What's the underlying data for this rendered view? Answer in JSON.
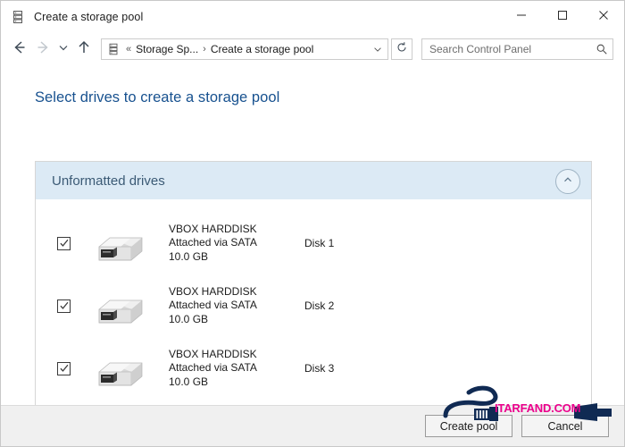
{
  "window": {
    "title": "Create a storage pool",
    "title_icon": "storage-pool-icon",
    "controls": {
      "minimize": "minimize-icon",
      "maximize": "maximize-icon",
      "close": "close-icon"
    }
  },
  "navigation": {
    "back": "back-arrow-icon",
    "forward": "forward-arrow-icon",
    "history": "chevron-down-icon",
    "up": "up-arrow-icon",
    "breadcrumb": {
      "icon": "storage-pool-icon",
      "overflow": "«",
      "parent": "Storage Sp...",
      "separator": "›",
      "current": "Create a storage pool",
      "dropdown": "chevron-down-icon"
    },
    "refresh": "refresh-icon"
  },
  "search": {
    "placeholder": "Search Control Panel",
    "value": "",
    "icon": "search-icon"
  },
  "main": {
    "page_title": "Select drives to create a storage pool",
    "panel": {
      "header": "Unformatted drives",
      "collapse_icon": "chevron-up-icon",
      "collapsed": false,
      "drives": [
        {
          "checked": true,
          "icon": "hard-disk-icon",
          "name": "VBOX HARDDISK",
          "attachment": "Attached via SATA",
          "capacity": "10.0 GB",
          "slot": "Disk 1"
        },
        {
          "checked": true,
          "icon": "hard-disk-icon",
          "name": "VBOX HARDDISK",
          "attachment": "Attached via SATA",
          "capacity": "10.0 GB",
          "slot": "Disk 2"
        },
        {
          "checked": true,
          "icon": "hard-disk-icon",
          "name": "VBOX HARDDISK",
          "attachment": "Attached via SATA",
          "capacity": "10.0 GB",
          "slot": "Disk 3"
        }
      ]
    }
  },
  "footer": {
    "create_pool_label": "Create pool",
    "cancel_label": "Cancel"
  },
  "watermark": {
    "text": "ITARFAND.COM"
  },
  "colors": {
    "heading_blue": "#17518f",
    "panel_header_blue": "#dceaf5",
    "panel_header_text": "#3b5a75",
    "footer_gray": "#f0f0f0",
    "watermark_magenta": "#ec008c",
    "watermark_navy": "#102a53"
  }
}
